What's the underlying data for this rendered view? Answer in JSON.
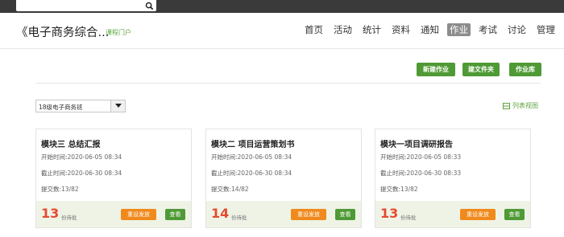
{
  "topbar": {
    "search_placeholder": "",
    "search_icon": "search-icon"
  },
  "header": {
    "course_title": "《电子商务综合...",
    "portal_link": "课程门户",
    "nav": [
      "首页",
      "活动",
      "统计",
      "资料",
      "通知",
      "作业",
      "考试",
      "讨论",
      "管理"
    ],
    "active_nav": "作业"
  },
  "toolbar": {
    "new_assignment": "新建作业",
    "new_folder": "建文件夹",
    "assignment_library": "作业库"
  },
  "filter": {
    "class_selected": "18级电子商务班",
    "list_view": "列表视图"
  },
  "cards": [
    {
      "title": "模块三 总结汇报",
      "start_label": "开始时间:",
      "start": "2020-06-05 08:34",
      "end_label": "截止时间:",
      "end": "2020-06-30 08:34",
      "submit_label": "提交数:",
      "submitted": "13/82",
      "pending": "13",
      "pending_label": "份待批",
      "redistribute": "重设发放",
      "view": "查看"
    },
    {
      "title": "模块二 项目运营策划书",
      "start_label": "开始时间:",
      "start": "2020-06-05 08:34",
      "end_label": "截止时间:",
      "end": "2020-06-30 08:34",
      "submit_label": "提交数:",
      "submitted": "14/82",
      "pending": "14",
      "pending_label": "份待批",
      "redistribute": "重设发放",
      "view": "查看"
    },
    {
      "title": "模块一项目调研报告",
      "start_label": "开始时间:",
      "start": "2020-06-05 08:33",
      "end_label": "截止时间:",
      "end": "2020-06-30 08:33",
      "submit_label": "提交数:",
      "submitted": "13/82",
      "pending": "13",
      "pending_label": "份待批",
      "redistribute": "重设发放",
      "view": "查看"
    }
  ],
  "colors": {
    "accent_green": "#4f9a35",
    "orange": "#f08a1c",
    "pending_red": "#e64a2e",
    "active_nav_bg": "#8c8c8c"
  }
}
